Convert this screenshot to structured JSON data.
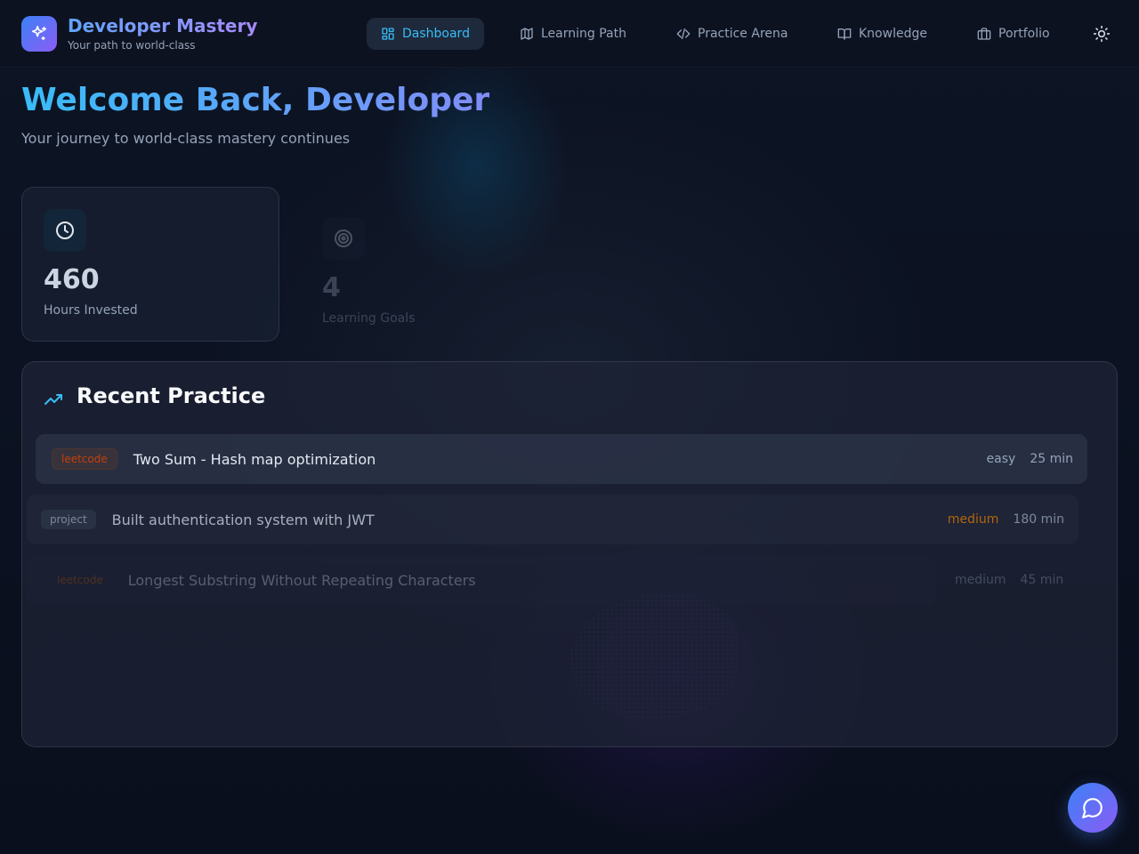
{
  "brand": {
    "title": "Developer Mastery",
    "subtitle": "Your path to world-class",
    "logo_icon": "sparkles-icon"
  },
  "nav": {
    "items": [
      {
        "label": "Dashboard",
        "icon": "dashboard-icon",
        "active": true
      },
      {
        "label": "Learning Path",
        "icon": "map-icon",
        "active": false
      },
      {
        "label": "Practice Arena",
        "icon": "code-icon",
        "active": false
      },
      {
        "label": "Knowledge",
        "icon": "book-icon",
        "active": false
      },
      {
        "label": "Portfolio",
        "icon": "briefcase-icon",
        "active": false
      }
    ],
    "theme_toggle_icon": "sun-icon"
  },
  "hero": {
    "title": "Welcome Back, Developer",
    "subtitle": "Your journey to world-class mastery continues"
  },
  "stats": [
    {
      "value": "460",
      "label": "Hours Invested",
      "icon": "clock-icon"
    },
    {
      "value": "4",
      "label": "Learning Goals",
      "icon": "target-icon"
    }
  ],
  "recent_practice": {
    "title": "Recent Practice",
    "icon": "trending-up-icon",
    "items": [
      {
        "source": "leetcode",
        "title": "Two Sum - Hash map optimization",
        "difficulty": "easy",
        "duration": "25 min"
      },
      {
        "source": "project",
        "title": "Built authentication system with JWT",
        "difficulty": "medium",
        "duration": "180 min"
      },
      {
        "source": "leetcode",
        "title": "Longest Substring Without Repeating Characters",
        "difficulty": "medium",
        "duration": "45 min"
      }
    ]
  },
  "chat_button": {
    "icon": "chat-bubble-icon"
  },
  "colors": {
    "background": "#0b1120",
    "accent_blue": "#38bdf8",
    "accent_purple": "#8b5cf6",
    "difficulty_medium": "#d97706",
    "source_leetcode": "#c2410c"
  }
}
